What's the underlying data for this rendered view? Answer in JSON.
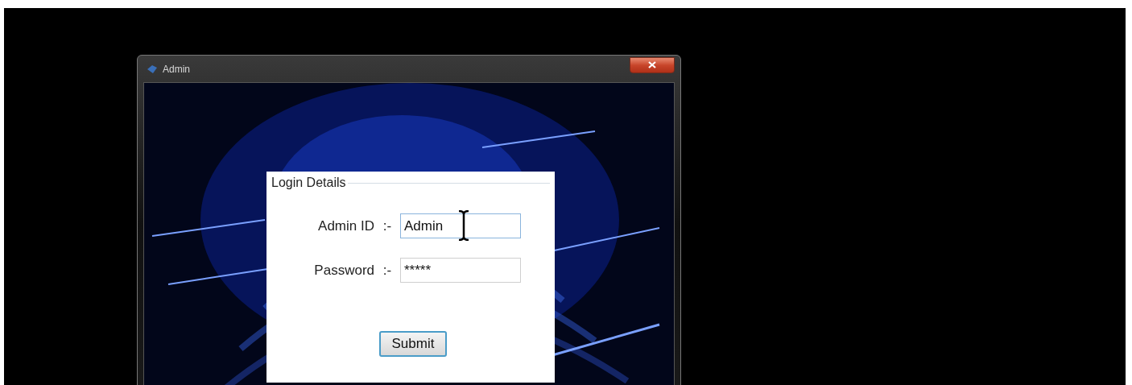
{
  "window": {
    "title": "Admin"
  },
  "login_group": {
    "title": "Login Details",
    "fields": [
      {
        "label": "Admin ID",
        "separator": ":-",
        "value": "Admin",
        "focused": true
      },
      {
        "label": "Password",
        "separator": ":-",
        "value": "*****",
        "focused": false
      }
    ],
    "submit_button": "Submit"
  }
}
